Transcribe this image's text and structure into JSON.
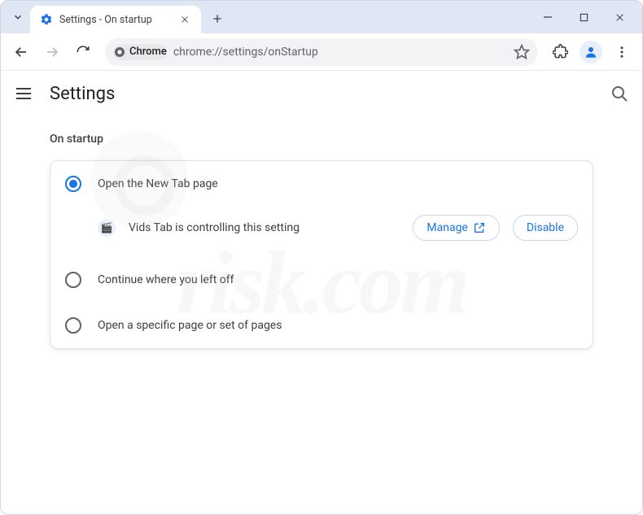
{
  "window": {
    "tab_title": "Settings - On startup"
  },
  "toolbar": {
    "origin_chip": "Chrome",
    "url": "chrome://settings/onStartup"
  },
  "header": {
    "title": "Settings"
  },
  "section": {
    "title": "On startup",
    "options": [
      {
        "label": "Open the New Tab page",
        "selected": true
      },
      {
        "label": "Continue where you left off",
        "selected": false
      },
      {
        "label": "Open a specific page or set of pages",
        "selected": false
      }
    ],
    "controlled_by": {
      "extension_name": "Vids Tab",
      "message": "Vids Tab is controlling this setting",
      "manage_label": "Manage",
      "disable_label": "Disable"
    }
  }
}
